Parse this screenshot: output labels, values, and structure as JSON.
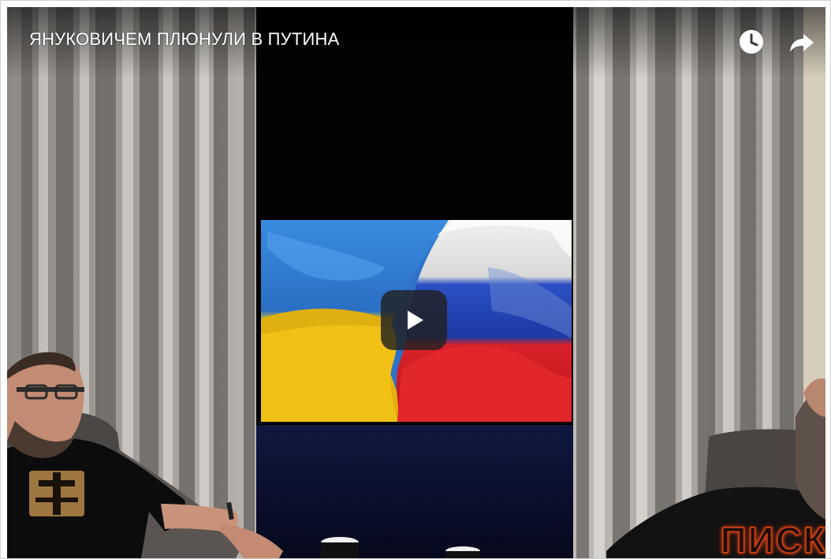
{
  "video": {
    "title": "ЯНУКОВИЧЕМ ПЛЮНУЛИ В ПУТИНА",
    "watermark_text": "ПИСК"
  },
  "actions": {
    "watch_later_icon": "clock-icon",
    "share_icon": "share-arrow-icon",
    "play_icon": "play-icon"
  },
  "colors": {
    "play_button_bg": "#212121",
    "title_text": "#ffffff",
    "ukraine_blue": "#2b7fd1",
    "ukraine_yellow": "#f0c21c",
    "russia_white": "#eeeeee",
    "russia_blue": "#1f3fb0",
    "russia_red": "#d41c24"
  }
}
